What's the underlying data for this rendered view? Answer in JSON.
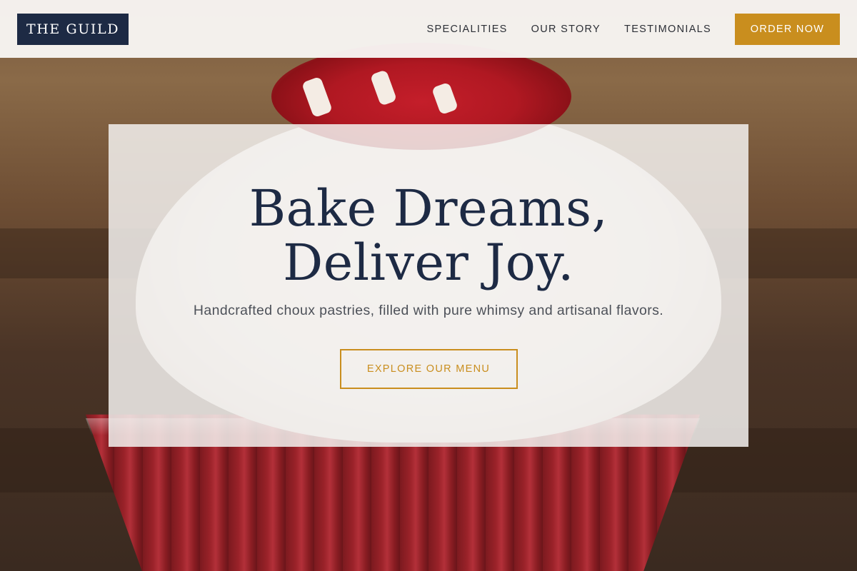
{
  "brand": {
    "name": "THE GUILD",
    "accent_color": "#c98e1e",
    "navy_color": "#1d2a44"
  },
  "nav": {
    "items": [
      {
        "label": "SPECIALITIES"
      },
      {
        "label": "OUR STORY"
      },
      {
        "label": "TESTIMONIALS"
      }
    ],
    "cta_label": "ORDER NOW"
  },
  "hero": {
    "title": "Bake Dreams, Deliver Joy.",
    "subtitle": "Handcrafted choux pastries, filled with pure whimsy and artisanal flavors.",
    "button_label": "EXPLORE OUR MENU",
    "background": "red-velvet-cupcake-photo"
  }
}
